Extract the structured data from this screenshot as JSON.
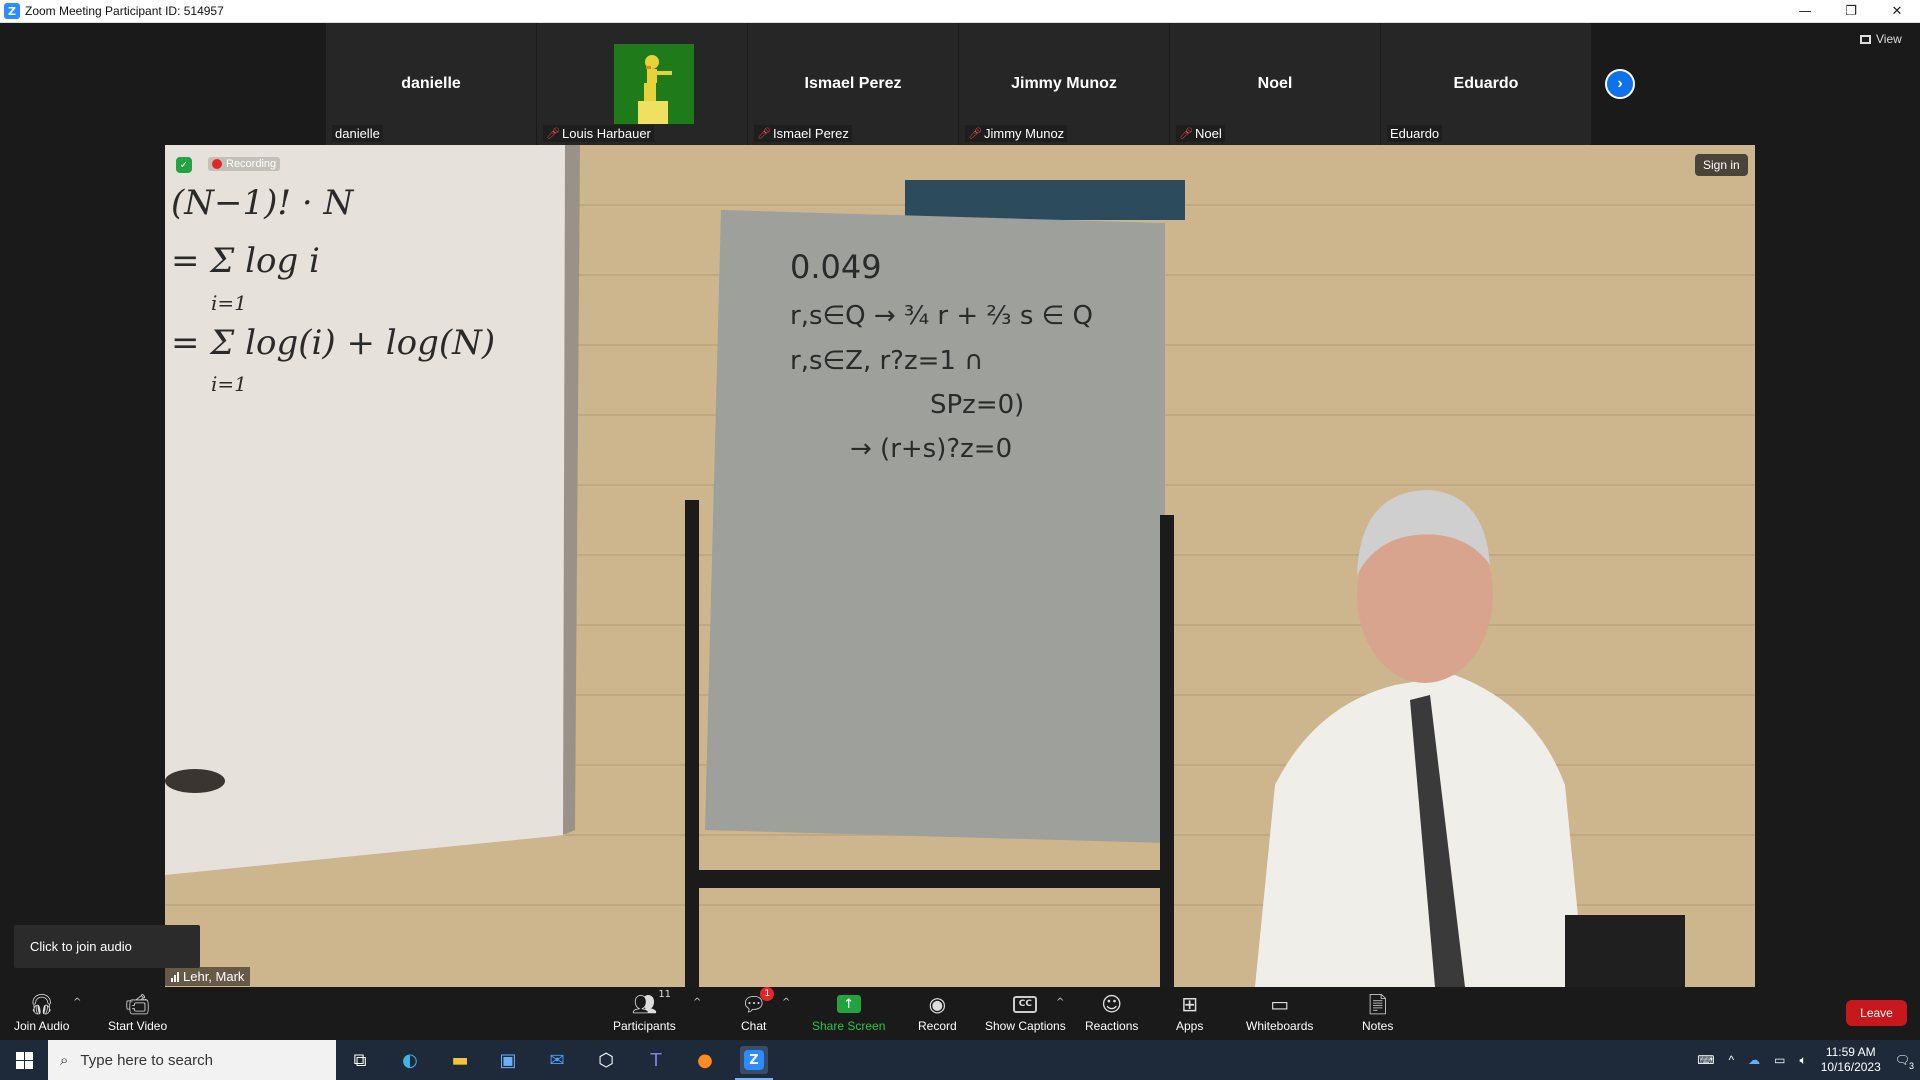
{
  "window": {
    "title": "Zoom Meeting Participant ID: 514957",
    "app_icon_letter": "Z",
    "minimize_glyph": "—",
    "restore_glyph": "❐",
    "close_glyph": "✕"
  },
  "top_controls": {
    "view_label": "View"
  },
  "gallery": {
    "participants": [
      {
        "display_name": "danielle",
        "tag": "danielle",
        "muted": false,
        "has_picture": false
      },
      {
        "display_name": "",
        "tag": "Louis Harbauer",
        "muted": true,
        "has_picture": true
      },
      {
        "display_name": "Ismael Perez",
        "tag": "Ismael Perez",
        "muted": true,
        "has_picture": false
      },
      {
        "display_name": "Jimmy Munoz",
        "tag": "Jimmy Munoz",
        "muted": true,
        "has_picture": false
      },
      {
        "display_name": "Noel",
        "tag": "Noel",
        "muted": true,
        "has_picture": false
      },
      {
        "display_name": "Eduardo",
        "tag": "Eduardo",
        "muted": false,
        "has_picture": false
      }
    ],
    "next_page_glyph": "›"
  },
  "main_video": {
    "recording_label": "Recording",
    "sign_in_label": "Sign in",
    "speaker_name": "Lehr, Mark",
    "board_text_center": [
      "0.049",
      "r,s∈Q → ³⁄₄ r + ²⁄₃ s ∈ Q",
      "r,s∈Z, r?z=1 ∩",
      "SPz=0)",
      "→ (r+s)?z=0"
    ],
    "board_text_left": [
      "(N−1)! · N",
      "= Σ log i",
      "i=1",
      "= Σ log(i) + log(N)",
      "i=1"
    ]
  },
  "tooltip": {
    "text": "Click to join audio"
  },
  "toolbar": {
    "join_audio": "Join Audio",
    "start_video": "Start Video",
    "participants": "Participants",
    "participants_count": "11",
    "chat": "Chat",
    "chat_unread": "1",
    "share_screen": "Share Screen",
    "record": "Record",
    "show_captions": "Show Captions",
    "reactions": "Reactions",
    "apps": "Apps",
    "whiteboards": "Whiteboards",
    "notes": "Notes",
    "leave": "Leave"
  },
  "taskbar": {
    "search_placeholder": "Type here to search",
    "time": "11:59 AM",
    "date": "10/16/2023",
    "notification_count": "3"
  },
  "colors": {
    "accent": "#0e72ed",
    "share_green": "#23a340",
    "leave_red": "#c8181b",
    "muted_red": "#e5484d"
  }
}
